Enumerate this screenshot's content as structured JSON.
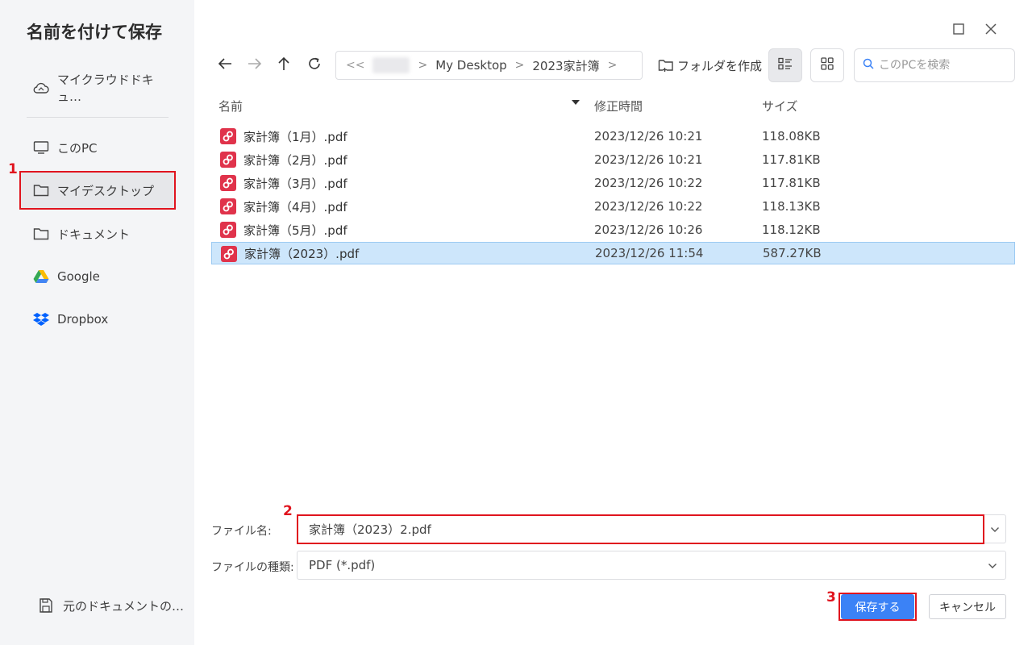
{
  "sidebar": {
    "title": "名前を付けて保存",
    "items": [
      {
        "label": "マイクラウドドキュ…",
        "icon": "cloud-icon"
      },
      {
        "label": "このPC",
        "icon": "monitor-icon"
      },
      {
        "label": "マイデスクトップ",
        "icon": "folder-icon"
      },
      {
        "label": "ドキュメント",
        "icon": "folder-icon"
      },
      {
        "label": "Google",
        "icon": "google-drive-icon"
      },
      {
        "label": "Dropbox",
        "icon": "dropbox-icon"
      }
    ],
    "bottom_label": "元のドキュメントの…"
  },
  "annotations": {
    "m1": "1",
    "m2": "2",
    "m3": "3",
    "color": "#e0141e"
  },
  "breadcrumb": {
    "back_glyph": "<<",
    "items": [
      "My Desktop",
      "2023家計簿"
    ]
  },
  "toolbar": {
    "new_folder_label": "フォルダを作成"
  },
  "search": {
    "placeholder": "このPCを検索"
  },
  "table": {
    "headers": {
      "name": "名前",
      "modified": "修正時間",
      "size": "サイズ"
    },
    "rows": [
      {
        "name": "家計簿（1月）.pdf",
        "date": "2023/12/26 10:21",
        "size": "118.08KB"
      },
      {
        "name": "家計簿（2月）.pdf",
        "date": "2023/12/26 10:21",
        "size": "117.81KB"
      },
      {
        "name": "家計簿（3月）.pdf",
        "date": "2023/12/26 10:22",
        "size": "117.81KB"
      },
      {
        "name": "家計簿（4月）.pdf",
        "date": "2023/12/26 10:22",
        "size": "118.13KB"
      },
      {
        "name": "家計簿（5月）.pdf",
        "date": "2023/12/26 10:26",
        "size": "118.12KB"
      },
      {
        "name": "家計簿（2023）.pdf",
        "date": "2023/12/26 11:54",
        "size": "587.27KB"
      }
    ]
  },
  "form": {
    "filename_label": "ファイル名:",
    "filename_value": "家計簿（2023）2.pdf",
    "filetype_label": "ファイルの種類:",
    "filetype_value": "PDF (*.pdf)"
  },
  "buttons": {
    "save": "保存する",
    "cancel": "キャンセル"
  },
  "colors": {
    "accent": "#3b82f6",
    "selected_row": "#cde6fb",
    "pdf_icon": "#e0334b"
  }
}
